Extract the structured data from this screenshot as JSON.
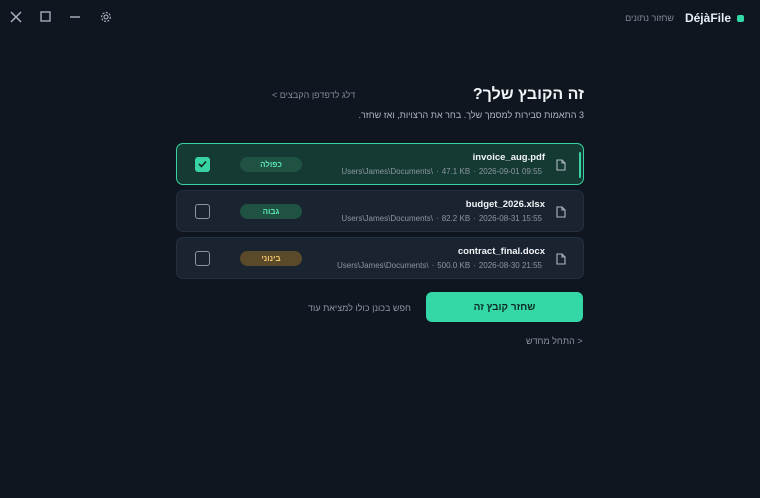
{
  "app": {
    "name": "DéjàFile",
    "accent": "#34d8a6",
    "recover_link": "שחזור נתונים"
  },
  "header": {
    "title": "זה הקובץ שלך?",
    "subtitle": "3 התאמות סבירות למסמך שלך. בחר את הרצויות, ואז שחזר.",
    "skip_link": "דלג לדפדפן הקבצים >"
  },
  "files": [
    {
      "name": "invoice_aug.pdf",
      "date": "2026-09-01 09:55",
      "size": "47.1 KB",
      "path": "Users\\James\\Documents\\",
      "badge": "כפולה",
      "badge_color": "#5be2b4",
      "selected": true
    },
    {
      "name": "budget_2026.xlsx",
      "date": "2026-08-31 15:55",
      "size": "82.2 KB",
      "path": "Users\\James\\Documents\\",
      "badge": "גבוה",
      "badge_color": "#5be2b4",
      "selected": false
    },
    {
      "name": "contract_final.docx",
      "date": "2026-08-30 21:55",
      "size": "500.0 KB",
      "path": "Users\\James\\Documents\\",
      "badge": "בינוני",
      "badge_color": "#f1c46a",
      "selected": false
    }
  ],
  "actions": {
    "primary": "שחזר קובץ זה",
    "secondary": "חפש בכונן כולו למציאת עוד",
    "restart": "< התחל מחדש"
  }
}
